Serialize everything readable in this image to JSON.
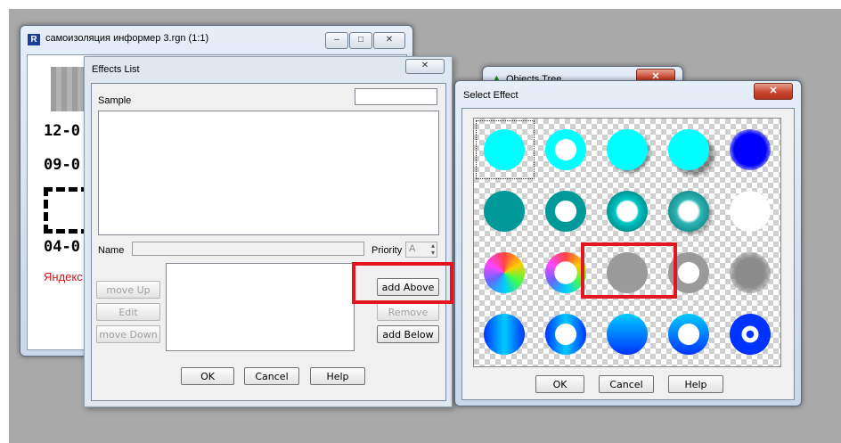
{
  "colors": {
    "highlight": "#e3161f",
    "cyan": "#00ffff",
    "teal": "#009999",
    "blue": "#0000ff",
    "deep_blue": "#0033ff",
    "gray": "#999999"
  },
  "back_window": {
    "title": "самоизоляция информер 3.rgn  (1:1)",
    "app_icon": "R",
    "icons": {
      "minimize": "minimize-icon",
      "maximize": "maximize-icon",
      "close": "close-icon"
    },
    "lines": [
      "12-0",
      "09-0",
      "04-0"
    ],
    "footer": "Яндекс"
  },
  "objects_tree": {
    "title": "Objects Tree",
    "icon": "tree-icon"
  },
  "effects_list": {
    "title": "Effects List",
    "close_icon": "close-icon",
    "sample_label": "Sample",
    "name_label": "Name",
    "name_value": "",
    "priority_label": "Priority",
    "priority_value": "A",
    "buttons": {
      "move_up": "move Up",
      "edit": "Edit",
      "move_down": "move Down",
      "add_above": "add Above",
      "remove": "Remove",
      "add_below": "add Below",
      "ok": "OK",
      "cancel": "Cancel",
      "help": "Help"
    }
  },
  "select_effect": {
    "title": "Select Effect",
    "close_icon": "close-icon",
    "effects": [
      {
        "name": "cyan-circle-effect",
        "icon": "circle-icon"
      },
      {
        "name": "cyan-ring-effect",
        "icon": "ring-icon"
      },
      {
        "name": "cyan-circle-shadow-effect",
        "icon": "circle-icon"
      },
      {
        "name": "cyan-circle-drop-shadow-effect",
        "icon": "circle-icon"
      },
      {
        "name": "blue-glow-circle-effect",
        "icon": "glow-icon"
      },
      {
        "name": "teal-circle-effect",
        "icon": "circle-icon"
      },
      {
        "name": "teal-ring-effect",
        "icon": "ring-icon"
      },
      {
        "name": "teal-gradient-ring-effect",
        "icon": "ring-icon"
      },
      {
        "name": "teal-shaded-ring-effect",
        "icon": "ring-icon"
      },
      {
        "name": "blue-glow-ring-effect",
        "icon": "ring-icon"
      },
      {
        "name": "rainbow-circle-effect",
        "icon": "circle-icon"
      },
      {
        "name": "rainbow-ring-effect",
        "icon": "ring-icon"
      },
      {
        "name": "gray-texture-circle-effect",
        "icon": "circle-icon"
      },
      {
        "name": "gray-texture-ring-effect",
        "icon": "ring-icon"
      },
      {
        "name": "gray-blur-circle-effect",
        "icon": "glow-icon"
      },
      {
        "name": "blue-gradient-circle-effect",
        "icon": "circle-icon"
      },
      {
        "name": "blue-gradient-ring-effect",
        "icon": "ring-icon"
      },
      {
        "name": "blue-shaded-circle-effect",
        "icon": "circle-icon"
      },
      {
        "name": "blue-shaded-ring-effect",
        "icon": "ring-icon"
      },
      {
        "name": "blue-radial-circle-effect",
        "icon": "circle-icon"
      }
    ],
    "selected_index": 0,
    "buttons": {
      "ok": "OK",
      "cancel": "Cancel",
      "help": "Help"
    }
  }
}
